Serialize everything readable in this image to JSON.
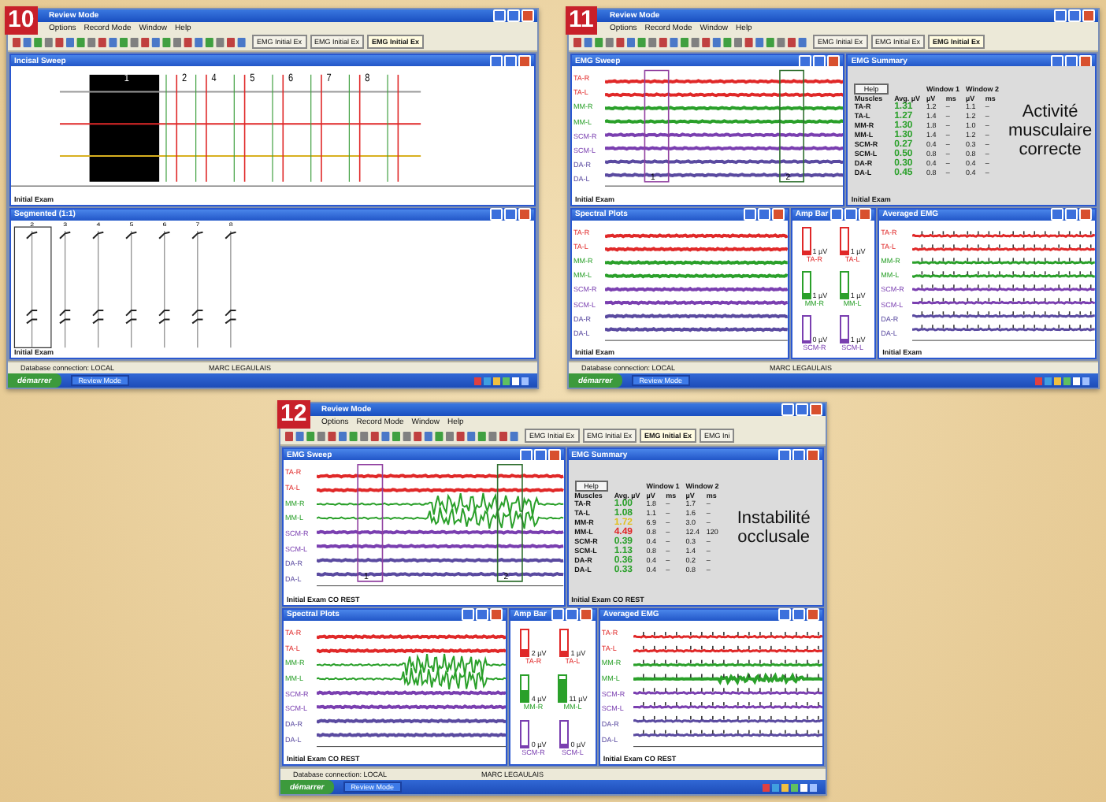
{
  "screens": [
    {
      "badge": "10",
      "title": "Review Mode",
      "menu": [
        "Options",
        "Record Mode",
        "Window",
        "Help"
      ],
      "doc_tabs": [
        {
          "label": "EMG Initial Ex",
          "selected": false
        },
        {
          "label": "EMG Initial Ex",
          "selected": false
        },
        {
          "label": "EMG Initial Ex",
          "selected": true
        }
      ],
      "rows": [
        {
          "windows": [
            {
              "kind": "kinesio",
              "title": "Incisal Sweep",
              "footer": "Initial Exam",
              "markers": [
                "1",
                "2",
                "4",
                "5",
                "6",
                "7",
                "8"
              ]
            }
          ]
        },
        {
          "windows": [
            {
              "kind": "segmented",
              "title": "Segmented (1:1)",
              "footer": "Initial Exam",
              "columns": [
                "2",
                "3",
                "4",
                "5",
                "6",
                "7",
                "8"
              ]
            }
          ]
        }
      ],
      "status": "Database connection: LOCAL",
      "status_right": "MARC LEGAULAIS",
      "start": "démarrer",
      "task": "Review Mode"
    },
    {
      "badge": "11",
      "title": "Review Mode",
      "menu": [
        "Options",
        "Record Mode",
        "Window",
        "Help"
      ],
      "doc_tabs": [
        {
          "label": "EMG Initial Ex",
          "selected": false
        },
        {
          "label": "EMG Initial Ex",
          "selected": false
        },
        {
          "label": "EMG Initial Ex",
          "selected": true
        }
      ],
      "rows": [
        {
          "windows": [
            {
              "kind": "sweep",
              "title": "EMG Sweep",
              "footer": "Initial Exam",
              "markers": [
                "1",
                "2"
              ],
              "channels": [
                {
                  "label": "TA-R",
                  "color": "#e02828",
                  "noisy": false
                },
                {
                  "label": "TA-L",
                  "color": "#e02828",
                  "noisy": false
                },
                {
                  "label": "MM-R",
                  "color": "#2aa02a",
                  "noisy": false
                },
                {
                  "label": "MM-L",
                  "color": "#2aa02a",
                  "noisy": false
                },
                {
                  "label": "SCM-R",
                  "color": "#7a3fb0",
                  "noisy": false
                },
                {
                  "label": "SCM-L",
                  "color": "#7a3fb0",
                  "noisy": false
                },
                {
                  "label": "DA-R",
                  "color": "#5a4aa0",
                  "noisy": false
                },
                {
                  "label": "DA-L",
                  "color": "#5a4aa0",
                  "noisy": false
                }
              ]
            },
            {
              "kind": "summary",
              "title": "EMG Summary",
              "footer": "Initial Exam",
              "help": "Help",
              "window_1": "Window 1",
              "window_2": "Window 2",
              "headers": [
                "Muscles",
                "Avg. µV",
                "µV",
                "ms",
                "µV",
                "ms"
              ],
              "note": "Activité musculaire correcte",
              "table": [
                {
                  "muscle": "TA-R",
                  "avg": "1.31",
                  "color": "#2aa02a",
                  "w1_uv": "1.2",
                  "w1_ms": "–",
                  "w2_uv": "1.1",
                  "w2_ms": "–"
                },
                {
                  "muscle": "TA-L",
                  "avg": "1.27",
                  "color": "#2aa02a",
                  "w1_uv": "1.4",
                  "w1_ms": "–",
                  "w2_uv": "1.2",
                  "w2_ms": "–"
                },
                {
                  "muscle": "MM-R",
                  "avg": "1.30",
                  "color": "#2aa02a",
                  "w1_uv": "1.8",
                  "w1_ms": "–",
                  "w2_uv": "1.0",
                  "w2_ms": "–"
                },
                {
                  "muscle": "MM-L",
                  "avg": "1.30",
                  "color": "#2aa02a",
                  "w1_uv": "1.4",
                  "w1_ms": "–",
                  "w2_uv": "1.2",
                  "w2_ms": "–"
                },
                {
                  "muscle": "SCM-R",
                  "avg": "0.27",
                  "color": "#2aa02a",
                  "w1_uv": "0.4",
                  "w1_ms": "–",
                  "w2_uv": "0.3",
                  "w2_ms": "–"
                },
                {
                  "muscle": "SCM-L",
                  "avg": "0.50",
                  "color": "#2aa02a",
                  "w1_uv": "0.8",
                  "w1_ms": "–",
                  "w2_uv": "0.8",
                  "w2_ms": "–"
                },
                {
                  "muscle": "DA-R",
                  "avg": "0.30",
                  "color": "#2aa02a",
                  "w1_uv": "0.4",
                  "w1_ms": "–",
                  "w2_uv": "0.4",
                  "w2_ms": "–"
                },
                {
                  "muscle": "DA-L",
                  "avg": "0.45",
                  "color": "#2aa02a",
                  "w1_uv": "0.8",
                  "w1_ms": "–",
                  "w2_uv": "0.4",
                  "w2_ms": "–"
                }
              ]
            }
          ]
        },
        {
          "windows": [
            {
              "kind": "spectral",
              "title": "Spectral Plots",
              "footer": "Initial Exam",
              "channels": [
                {
                  "label": "TA-R",
                  "color": "#e02828",
                  "noisy": false
                },
                {
                  "label": "TA-L",
                  "color": "#e02828",
                  "noisy": false
                },
                {
                  "label": "MM-R",
                  "color": "#2aa02a",
                  "noisy": false
                },
                {
                  "label": "MM-L",
                  "color": "#2aa02a",
                  "noisy": false
                },
                {
                  "label": "SCM-R",
                  "color": "#7a3fb0",
                  "noisy": false
                },
                {
                  "label": "SCM-L",
                  "color": "#7a3fb0",
                  "noisy": false
                },
                {
                  "label": "DA-R",
                  "color": "#5a4aa0",
                  "noisy": false
                },
                {
                  "label": "DA-L",
                  "color": "#5a4aa0",
                  "noisy": false
                }
              ]
            },
            {
              "kind": "bars",
              "title": "Amp Bar",
              "bars": [
                {
                  "label": "TA-R",
                  "value": "1 µV",
                  "level": 0.15,
                  "color": "#e02828"
                },
                {
                  "label": "TA-L",
                  "value": "1 µV",
                  "level": 0.15,
                  "color": "#e02828"
                },
                {
                  "label": "MM-R",
                  "value": "1 µV",
                  "level": 0.15,
                  "color": "#2aa02a"
                },
                {
                  "label": "MM-L",
                  "value": "1 µV",
                  "level": 0.15,
                  "color": "#2aa02a"
                },
                {
                  "label": "SCM-R",
                  "value": "0 µV",
                  "level": 0.05,
                  "color": "#7a3fb0"
                },
                {
                  "label": "SCM-L",
                  "value": "1 µV",
                  "level": 0.1,
                  "color": "#7a3fb0"
                }
              ]
            },
            {
              "kind": "grid",
              "title": "Averaged EMG",
              "footer": "Initial Exam",
              "channels": [
                {
                  "label": "TA-R",
                  "color": "#e02828",
                  "noisy": false
                },
                {
                  "label": "TA-L",
                  "color": "#e02828",
                  "noisy": false
                },
                {
                  "label": "MM-R",
                  "color": "#2aa02a",
                  "noisy": false
                },
                {
                  "label": "MM-L",
                  "color": "#2aa02a",
                  "noisy": false
                },
                {
                  "label": "SCM-R",
                  "color": "#7a3fb0",
                  "noisy": false
                },
                {
                  "label": "SCM-L",
                  "color": "#7a3fb0",
                  "noisy": false
                },
                {
                  "label": "DA-R",
                  "color": "#5a4aa0",
                  "noisy": false
                },
                {
                  "label": "DA-L",
                  "color": "#5a4aa0",
                  "noisy": false
                }
              ]
            }
          ]
        }
      ],
      "status": "Database connection: LOCAL",
      "status_right": "MARC LEGAULAIS",
      "start": "démarrer",
      "task": "Review Mode"
    },
    {
      "badge": "12",
      "title": "Review Mode",
      "menu": [
        "Options",
        "Record Mode",
        "Window",
        "Help"
      ],
      "doc_tabs": [
        {
          "label": "EMG Initial Ex",
          "selected": false
        },
        {
          "label": "EMG Initial Ex",
          "selected": false
        },
        {
          "label": "EMG Initial Ex",
          "selected": true
        },
        {
          "label": "EMG Ini",
          "selected": false
        }
      ],
      "rows": [
        {
          "windows": [
            {
              "kind": "sweep",
              "title": "EMG Sweep",
              "footer": "Initial Exam CO REST",
              "markers": [
                "1",
                "2"
              ],
              "channels": [
                {
                  "label": "TA-R",
                  "color": "#e02828",
                  "noisy": false
                },
                {
                  "label": "TA-L",
                  "color": "#e02828",
                  "noisy": false
                },
                {
                  "label": "MM-R",
                  "color": "#2aa02a",
                  "noisy": true
                },
                {
                  "label": "MM-L",
                  "color": "#2aa02a",
                  "noisy": true
                },
                {
                  "label": "SCM-R",
                  "color": "#7a3fb0",
                  "noisy": false
                },
                {
                  "label": "SCM-L",
                  "color": "#7a3fb0",
                  "noisy": false
                },
                {
                  "label": "DA-R",
                  "color": "#5a4aa0",
                  "noisy": false
                },
                {
                  "label": "DA-L",
                  "color": "#5a4aa0",
                  "noisy": false
                }
              ]
            },
            {
              "kind": "summary",
              "title": "EMG Summary",
              "footer": "Initial Exam CO REST",
              "help": "Help",
              "window_1": "Window 1",
              "window_2": "Window 2",
              "headers": [
                "Muscles",
                "Avg. µV",
                "µV",
                "ms",
                "µV",
                "ms"
              ],
              "note": "Instabilité occlusale",
              "table": [
                {
                  "muscle": "TA-R",
                  "avg": "1.00",
                  "color": "#2aa02a",
                  "w1_uv": "1.8",
                  "w1_ms": "–",
                  "w2_uv": "1.7",
                  "w2_ms": "–"
                },
                {
                  "muscle": "TA-L",
                  "avg": "1.08",
                  "color": "#2aa02a",
                  "w1_uv": "1.1",
                  "w1_ms": "–",
                  "w2_uv": "1.6",
                  "w2_ms": "–"
                },
                {
                  "muscle": "MM-R",
                  "avg": "1.72",
                  "color": "#e0c020",
                  "w1_uv": "6.9",
                  "w1_ms": "–",
                  "w2_uv": "3.0",
                  "w2_ms": "–"
                },
                {
                  "muscle": "MM-L",
                  "avg": "4.49",
                  "color": "#e02828",
                  "w1_uv": "0.8",
                  "w1_ms": "–",
                  "w2_uv": "12.4",
                  "w2_ms": "120"
                },
                {
                  "muscle": "SCM-R",
                  "avg": "0.39",
                  "color": "#2aa02a",
                  "w1_uv": "0.4",
                  "w1_ms": "–",
                  "w2_uv": "0.3",
                  "w2_ms": "–"
                },
                {
                  "muscle": "SCM-L",
                  "avg": "1.13",
                  "color": "#2aa02a",
                  "w1_uv": "0.8",
                  "w1_ms": "–",
                  "w2_uv": "1.4",
                  "w2_ms": "–"
                },
                {
                  "muscle": "DA-R",
                  "avg": "0.36",
                  "color": "#2aa02a",
                  "w1_uv": "0.4",
                  "w1_ms": "–",
                  "w2_uv": "0.2",
                  "w2_ms": "–"
                },
                {
                  "muscle": "DA-L",
                  "avg": "0.33",
                  "color": "#2aa02a",
                  "w1_uv": "0.4",
                  "w1_ms": "–",
                  "w2_uv": "0.8",
                  "w2_ms": "–"
                }
              ]
            }
          ]
        },
        {
          "windows": [
            {
              "kind": "spectral",
              "title": "Spectral Plots",
              "footer": "Initial Exam CO REST",
              "channels": [
                {
                  "label": "TA-R",
                  "color": "#e02828",
                  "noisy": false
                },
                {
                  "label": "TA-L",
                  "color": "#e02828",
                  "noisy": false
                },
                {
                  "label": "MM-R",
                  "color": "#2aa02a",
                  "noisy": true
                },
                {
                  "label": "MM-L",
                  "color": "#2aa02a",
                  "noisy": true
                },
                {
                  "label": "SCM-R",
                  "color": "#7a3fb0",
                  "noisy": false
                },
                {
                  "label": "SCM-L",
                  "color": "#7a3fb0",
                  "noisy": false
                },
                {
                  "label": "DA-R",
                  "color": "#5a4aa0",
                  "noisy": false
                },
                {
                  "label": "DA-L",
                  "color": "#5a4aa0",
                  "noisy": false
                }
              ]
            },
            {
              "kind": "bars",
              "title": "Amp Bar",
              "bars": [
                {
                  "label": "TA-R",
                  "value": "2 µV",
                  "level": 0.25,
                  "color": "#e02828"
                },
                {
                  "label": "TA-L",
                  "value": "1 µV",
                  "level": 0.15,
                  "color": "#e02828"
                },
                {
                  "label": "MM-R",
                  "value": "4 µV",
                  "level": 0.45,
                  "color": "#2aa02a"
                },
                {
                  "label": "MM-L",
                  "value": "11 µV",
                  "level": 0.85,
                  "color": "#2aa02a"
                },
                {
                  "label": "SCM-R",
                  "value": "0 µV",
                  "level": 0.05,
                  "color": "#7a3fb0"
                },
                {
                  "label": "SCM-L",
                  "value": "0 µV",
                  "level": 0.1,
                  "color": "#7a3fb0"
                }
              ]
            },
            {
              "kind": "grid",
              "title": "Averaged EMG",
              "footer": "Initial Exam CO REST",
              "channels": [
                {
                  "label": "TA-R",
                  "color": "#e02828",
                  "noisy": false
                },
                {
                  "label": "TA-L",
                  "color": "#e02828",
                  "noisy": false
                },
                {
                  "label": "MM-R",
                  "color": "#2aa02a",
                  "noisy": false
                },
                {
                  "label": "MM-L",
                  "color": "#2aa02a",
                  "noisy": true
                },
                {
                  "label": "SCM-R",
                  "color": "#7a3fb0",
                  "noisy": false
                },
                {
                  "label": "SCM-L",
                  "color": "#7a3fb0",
                  "noisy": false
                },
                {
                  "label": "DA-R",
                  "color": "#5a4aa0",
                  "noisy": false
                },
                {
                  "label": "DA-L",
                  "color": "#5a4aa0",
                  "noisy": false
                }
              ]
            }
          ]
        }
      ],
      "status": "Database connection: LOCAL",
      "status_right": "MARC LEGAULAIS",
      "start": "démarrer",
      "task": "Review Mode"
    }
  ]
}
